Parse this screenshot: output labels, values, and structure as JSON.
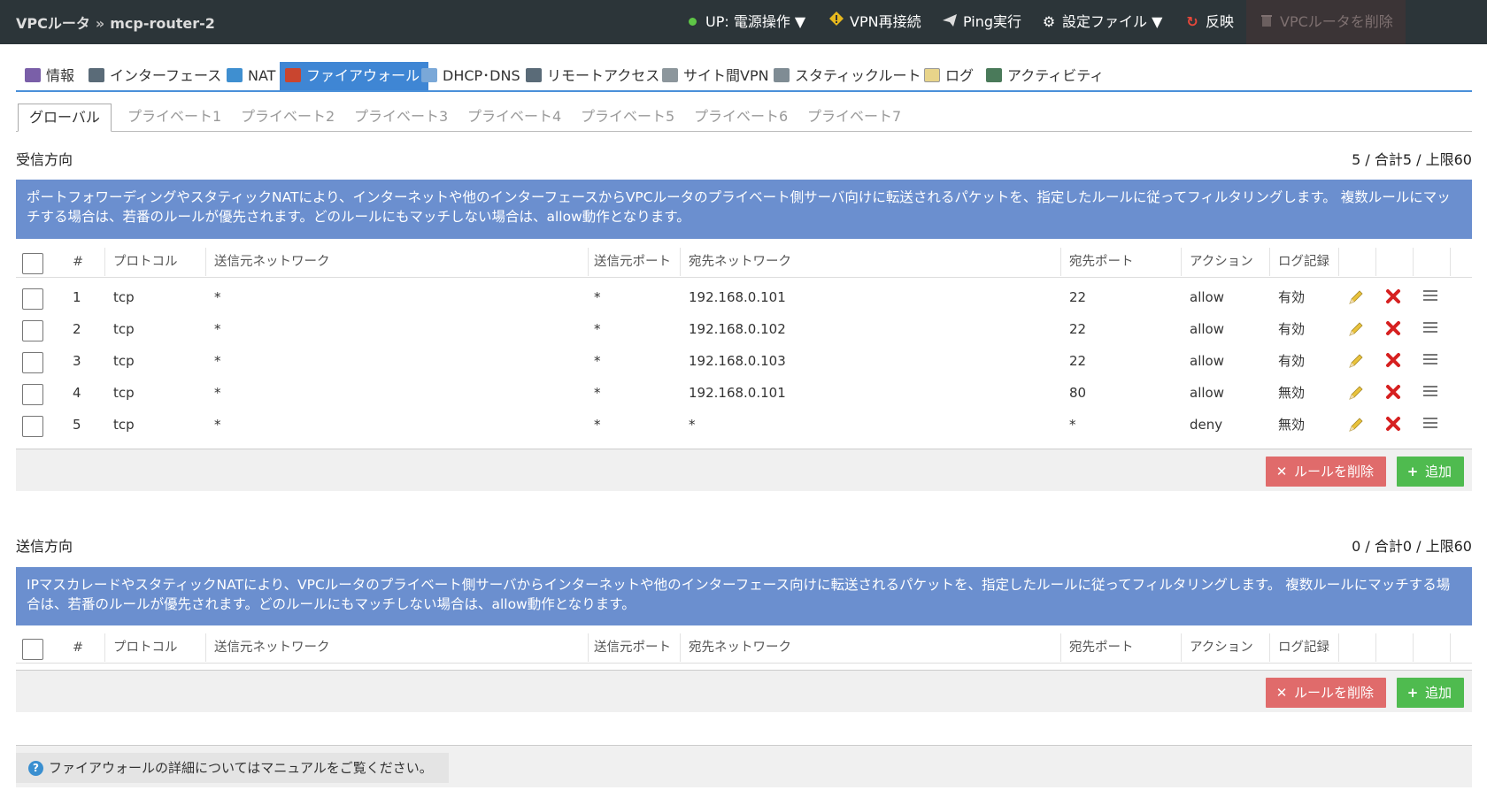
{
  "header": {
    "app": "VPCルータ",
    "separator": "»",
    "router_name": "mcp-router-2",
    "buttons": {
      "power": "UP: 電源操作 ▼",
      "vpn": "VPN再接続",
      "ping": "Ping実行",
      "config": "設定ファイル ▼",
      "apply": "反映",
      "delete": "VPCルータを削除"
    }
  },
  "main_tabs": [
    "情報",
    "インターフェース",
    "NAT",
    "ファイアウォール",
    "DHCP･DNS",
    "リモートアクセス",
    "サイト間VPN",
    "スタティックルート",
    "ログ",
    "アクティビティ"
  ],
  "sub_tabs": [
    "グローバル",
    "プライベート1",
    "プライベート2",
    "プライベート3",
    "プライベート4",
    "プライベート5",
    "プライベート6",
    "プライベート7"
  ],
  "columns": [
    "#",
    "プロトコル",
    "送信元ネットワーク",
    "送信元ポート",
    "宛先ネットワーク",
    "宛先ポート",
    "アクション",
    "ログ記録"
  ],
  "inbound": {
    "title": "受信方向",
    "count": "5 / 合計5 / 上限60",
    "description": "ポートフォワーディングやスタティックNATにより、インターネットや他のインターフェースからVPCルータのプライベート側サーバ向けに転送されるパケットを、指定したルールに従ってフィルタリングします。 複数ルールにマッチする場合は、若番のルールが優先されます。どのルールにもマッチしない場合は、allow動作となります。",
    "rows": [
      {
        "no": "1",
        "proto": "tcp",
        "src_net": "*",
        "src_port": "*",
        "dst_net": "192.168.0.101",
        "dst_port": "22",
        "action": "allow",
        "log": "有効"
      },
      {
        "no": "2",
        "proto": "tcp",
        "src_net": "*",
        "src_port": "*",
        "dst_net": "192.168.0.102",
        "dst_port": "22",
        "action": "allow",
        "log": "有効"
      },
      {
        "no": "3",
        "proto": "tcp",
        "src_net": "*",
        "src_port": "*",
        "dst_net": "192.168.0.103",
        "dst_port": "22",
        "action": "allow",
        "log": "有効"
      },
      {
        "no": "4",
        "proto": "tcp",
        "src_net": "*",
        "src_port": "*",
        "dst_net": "192.168.0.101",
        "dst_port": "80",
        "action": "allow",
        "log": "無効"
      },
      {
        "no": "5",
        "proto": "tcp",
        "src_net": "*",
        "src_port": "*",
        "dst_net": "*",
        "dst_port": "*",
        "action": "deny",
        "log": "無効"
      }
    ],
    "delete_label": "ルールを削除",
    "add_label": "追加"
  },
  "outbound": {
    "title": "送信方向",
    "count": "0 / 合計0 / 上限60",
    "description": "IPマスカレードやスタティックNATにより、VPCルータのプライベート側サーバからインターネットや他のインターフェース向けに転送されるパケットを、指定したルールに従ってフィルタリングします。 複数ルールにマッチする場合は、若番のルールが優先されます。どのルールにもマッチしない場合は、allow動作となります。",
    "delete_label": "ルールを削除",
    "add_label": "追加"
  },
  "help_text": "ファイアウォールの詳細についてはマニュアルをご覧ください。",
  "icons": {
    "edit": "pencil-icon",
    "remove": "x-icon",
    "drag": "menu-icon"
  },
  "colors": {
    "header_bg": "#2c3539",
    "active_tab": "#3f86d4",
    "desc_bg": "#6b8fcf",
    "delete_btn": "#e06b6b",
    "add_btn": "#4fbb4f",
    "status_up": "#5ec546"
  }
}
